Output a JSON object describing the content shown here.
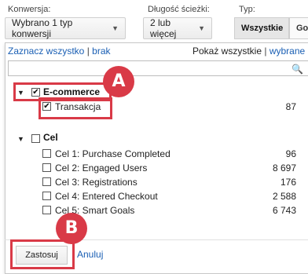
{
  "filters": {
    "conversion": {
      "label": "Konwersja:",
      "value": "Wybrano 1 typ konwersji"
    },
    "path_length": {
      "label": "Długość ścieżki:",
      "value": "2 lub więcej"
    },
    "type": {
      "label": "Typ:",
      "active": "Wszystkie",
      "next": "Goo"
    }
  },
  "panel": {
    "select_all": "Zaznacz wszystko",
    "separator": "|",
    "none": "brak",
    "show_all": "Pokaż wszystkie",
    "selected": "wybrane",
    "search": {
      "value": "",
      "placeholder": ""
    },
    "groups": [
      {
        "label": "E-commerce",
        "checked": true,
        "items": [
          {
            "label": "Transakcja",
            "checked": true,
            "count": "87"
          }
        ]
      },
      {
        "label": "Cel",
        "checked": false,
        "items": [
          {
            "label": "Cel 1: Purchase Completed",
            "checked": false,
            "count": "96"
          },
          {
            "label": "Cel 2: Engaged Users",
            "checked": false,
            "count": "8 697"
          },
          {
            "label": "Cel 3: Registrations",
            "checked": false,
            "count": "176"
          },
          {
            "label": "Cel 4: Entered Checkout",
            "checked": false,
            "count": "2 588"
          },
          {
            "label": "Cel 5: Smart Goals",
            "checked": false,
            "count": "6 743"
          }
        ]
      }
    ],
    "apply": "Zastosuj",
    "cancel": "Anuluj"
  },
  "annotations": {
    "a": "A",
    "b": "B",
    "color": "#d93a47"
  }
}
